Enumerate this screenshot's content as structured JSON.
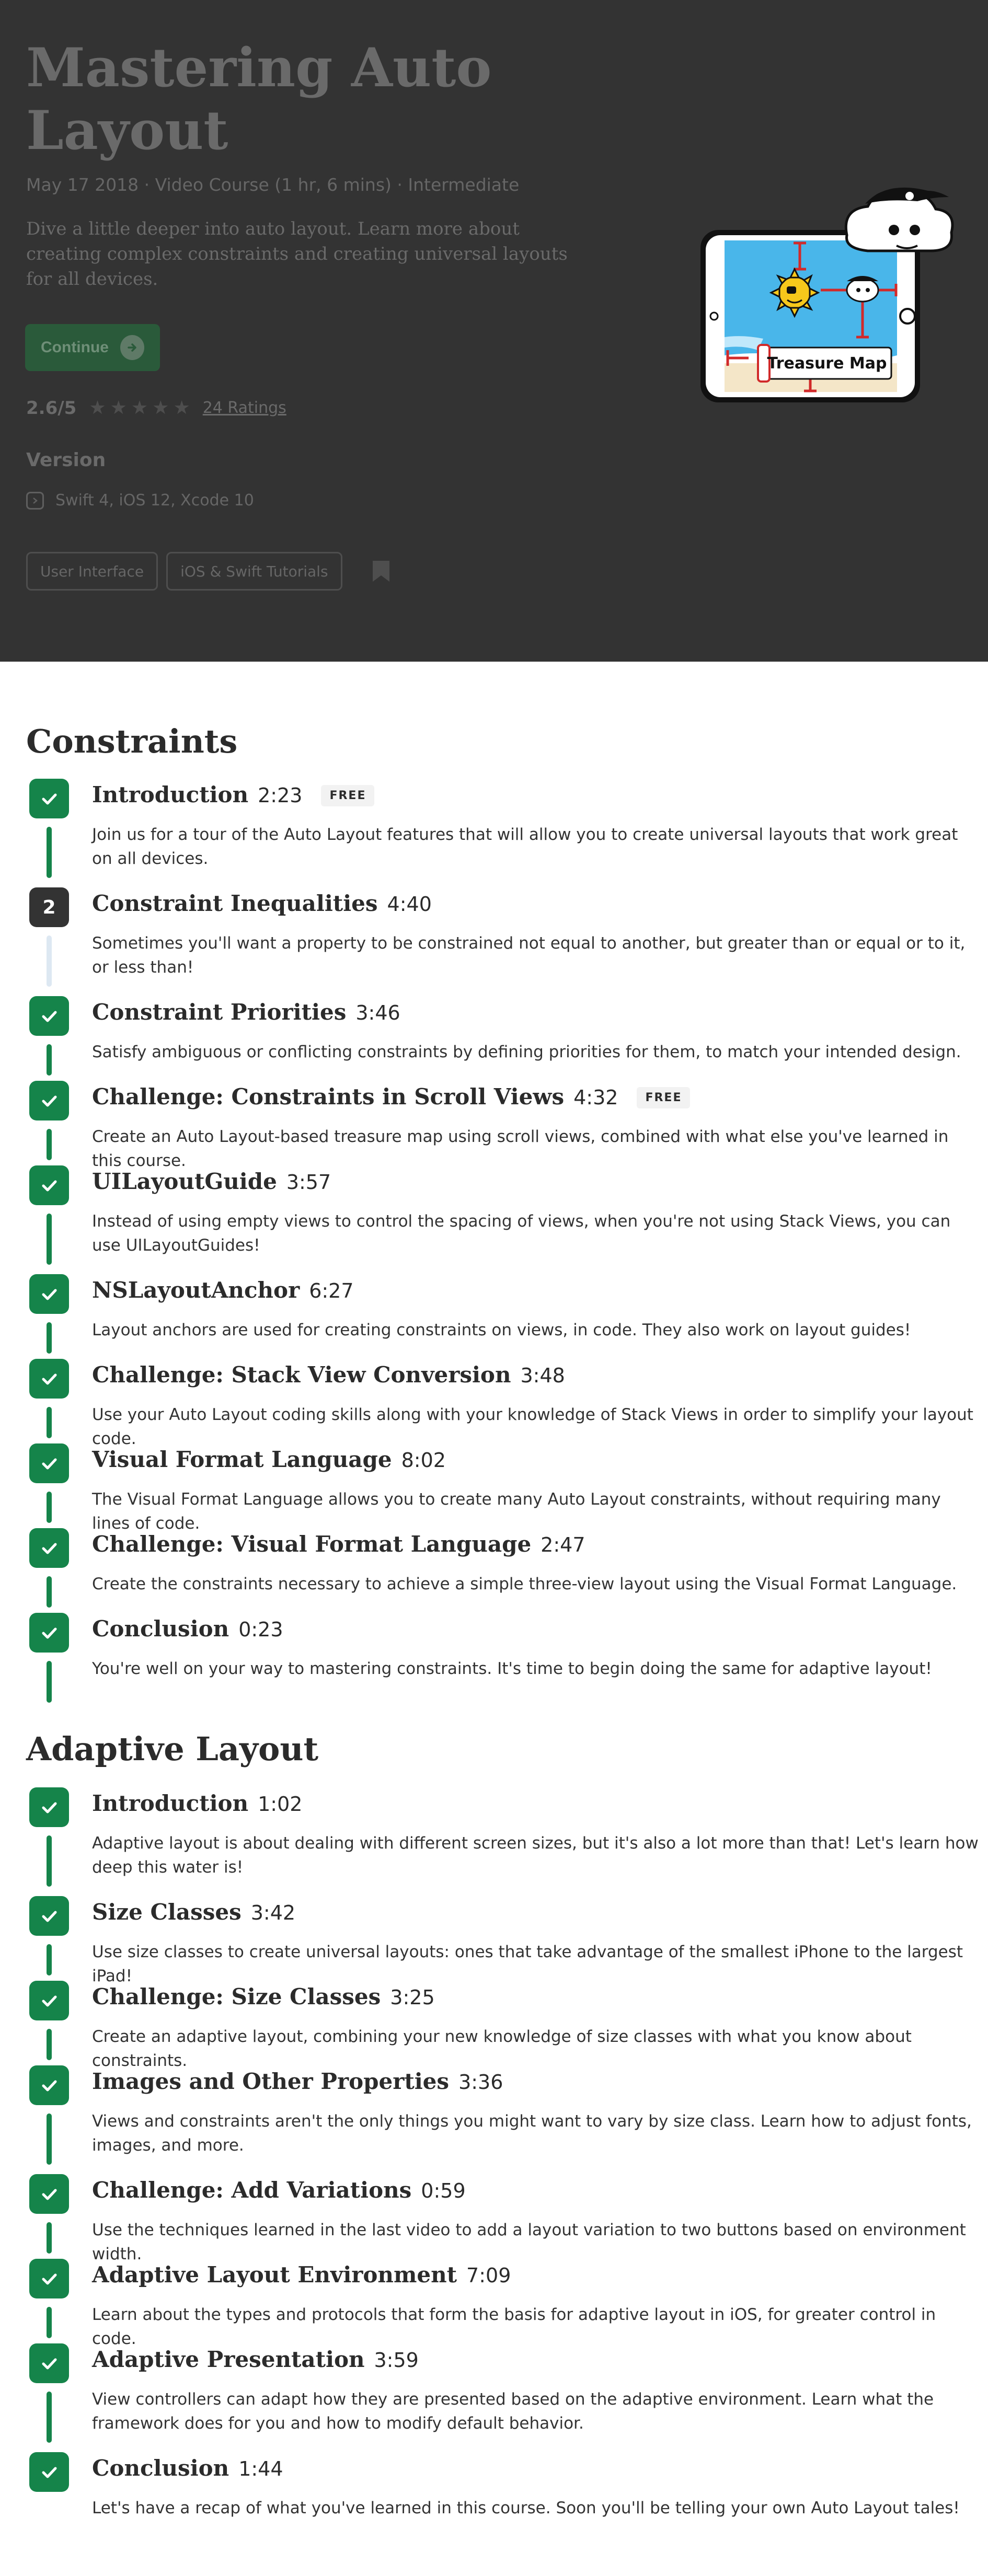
{
  "hero": {
    "title": "Mastering Auto Layout",
    "meta": "May 17 2018 · Video Course (1 hr, 6 mins) · Intermediate",
    "description": "Dive a little deeper into auto layout. Learn more about creating complex constraints and creating universal layouts for all devices.",
    "continue_label": "Continue",
    "rating": "2.6/5",
    "stars_filled": 0,
    "stars_total": 5,
    "ratings_link": "24 Ratings",
    "version_label": "Version",
    "version_text": "Swift 4, iOS 12, Xcode 10",
    "tags": [
      "User Interface",
      "iOS & Swift Tutorials"
    ],
    "art_caption": "Treasure Map"
  },
  "sections": [
    {
      "title": "Constraints",
      "lessons": [
        {
          "title": "Introduction",
          "duration": "2:23",
          "free": "FREE",
          "status": "complete",
          "description": "Join us for a tour of the Auto Layout features that will allow you to create universal layouts that work great on all devices."
        },
        {
          "title": "Constraint Inequalities",
          "duration": "4:40",
          "status": "current",
          "number": "2",
          "description": "Sometimes you'll want a property to be constrained not equal to another, but greater than or equal or to it, or less than!"
        },
        {
          "title": "Constraint Priorities",
          "duration": "3:46",
          "status": "complete",
          "description": "Satisfy ambiguous or conflicting constraints by defining priorities for them, to match your intended design."
        },
        {
          "title": "Challenge: Constraints in Scroll Views",
          "duration": "4:32",
          "free": "FREE",
          "status": "complete",
          "description": "Create an Auto Layout-based treasure map using scroll views, combined with what else you've learned in this course."
        },
        {
          "title": "UILayoutGuide",
          "duration": "3:57",
          "status": "complete",
          "description": "Instead of using empty views to control the spacing of views, when you're not using Stack Views, you can use UILayoutGuides!"
        },
        {
          "title": "NSLayoutAnchor",
          "duration": "6:27",
          "status": "complete",
          "description": "Layout anchors are used for creating constraints on views, in code. They also work on layout guides!"
        },
        {
          "title": "Challenge: Stack View Conversion",
          "duration": "3:48",
          "status": "complete",
          "description": "Use your Auto Layout coding skills along with your knowledge of Stack Views in order to simplify your layout code."
        },
        {
          "title": "Visual Format Language",
          "duration": "8:02",
          "status": "complete",
          "description": "The Visual Format Language allows you to create many Auto Layout constraints, without requiring many lines of code."
        },
        {
          "title": "Challenge: Visual Format Language",
          "duration": "2:47",
          "status": "complete",
          "description": "Create the constraints necessary to achieve a simple three-view layout using the Visual Format Language."
        },
        {
          "title": "Conclusion",
          "duration": "0:23",
          "status": "complete",
          "description": "You're well on your way to mastering constraints. It's time to begin doing the same for adaptive layout!"
        }
      ]
    },
    {
      "title": "Adaptive Layout",
      "lessons": [
        {
          "title": "Introduction",
          "duration": "1:02",
          "status": "complete",
          "description": "Adaptive layout is about dealing with different screen sizes, but it's also a lot more than that! Let's learn how deep this water is!"
        },
        {
          "title": "Size Classes",
          "duration": "3:42",
          "status": "complete",
          "description": "Use size classes to create universal layouts: ones that take advantage of the smallest iPhone to the largest iPad!"
        },
        {
          "title": "Challenge: Size Classes",
          "duration": "3:25",
          "status": "complete",
          "description": "Create an adaptive layout, combining your new knowledge of size classes with what you know about constraints."
        },
        {
          "title": "Images and Other Properties",
          "duration": "3:36",
          "status": "complete",
          "description": "Views and constraints aren't the only things you might want to vary by size class. Learn how to adjust fonts, images, and more."
        },
        {
          "title": "Challenge: Add Variations",
          "duration": "0:59",
          "status": "complete",
          "description": "Use the techniques learned in the last video to add a layout variation to two buttons based on environment width."
        },
        {
          "title": "Adaptive Layout Environment",
          "duration": "7:09",
          "status": "complete",
          "description": "Learn about the types and protocols that form the basis for adaptive layout in iOS, for greater control in code."
        },
        {
          "title": "Adaptive Presentation",
          "duration": "3:59",
          "status": "complete",
          "description": "View controllers can adapt how they are presented based on the adaptive environment. Learn what the framework does for you and how to modify default behavior."
        },
        {
          "title": "Conclusion",
          "duration": "1:44",
          "status": "complete",
          "description": "Let's have a recap of what you've learned in this course. Soon you'll be telling your own Auto Layout tales!"
        }
      ]
    }
  ],
  "colors": {
    "hero_bg": "#333333",
    "complete_green": "#15844a",
    "current_dark": "#333333",
    "connector_light": "#dde8f2"
  }
}
